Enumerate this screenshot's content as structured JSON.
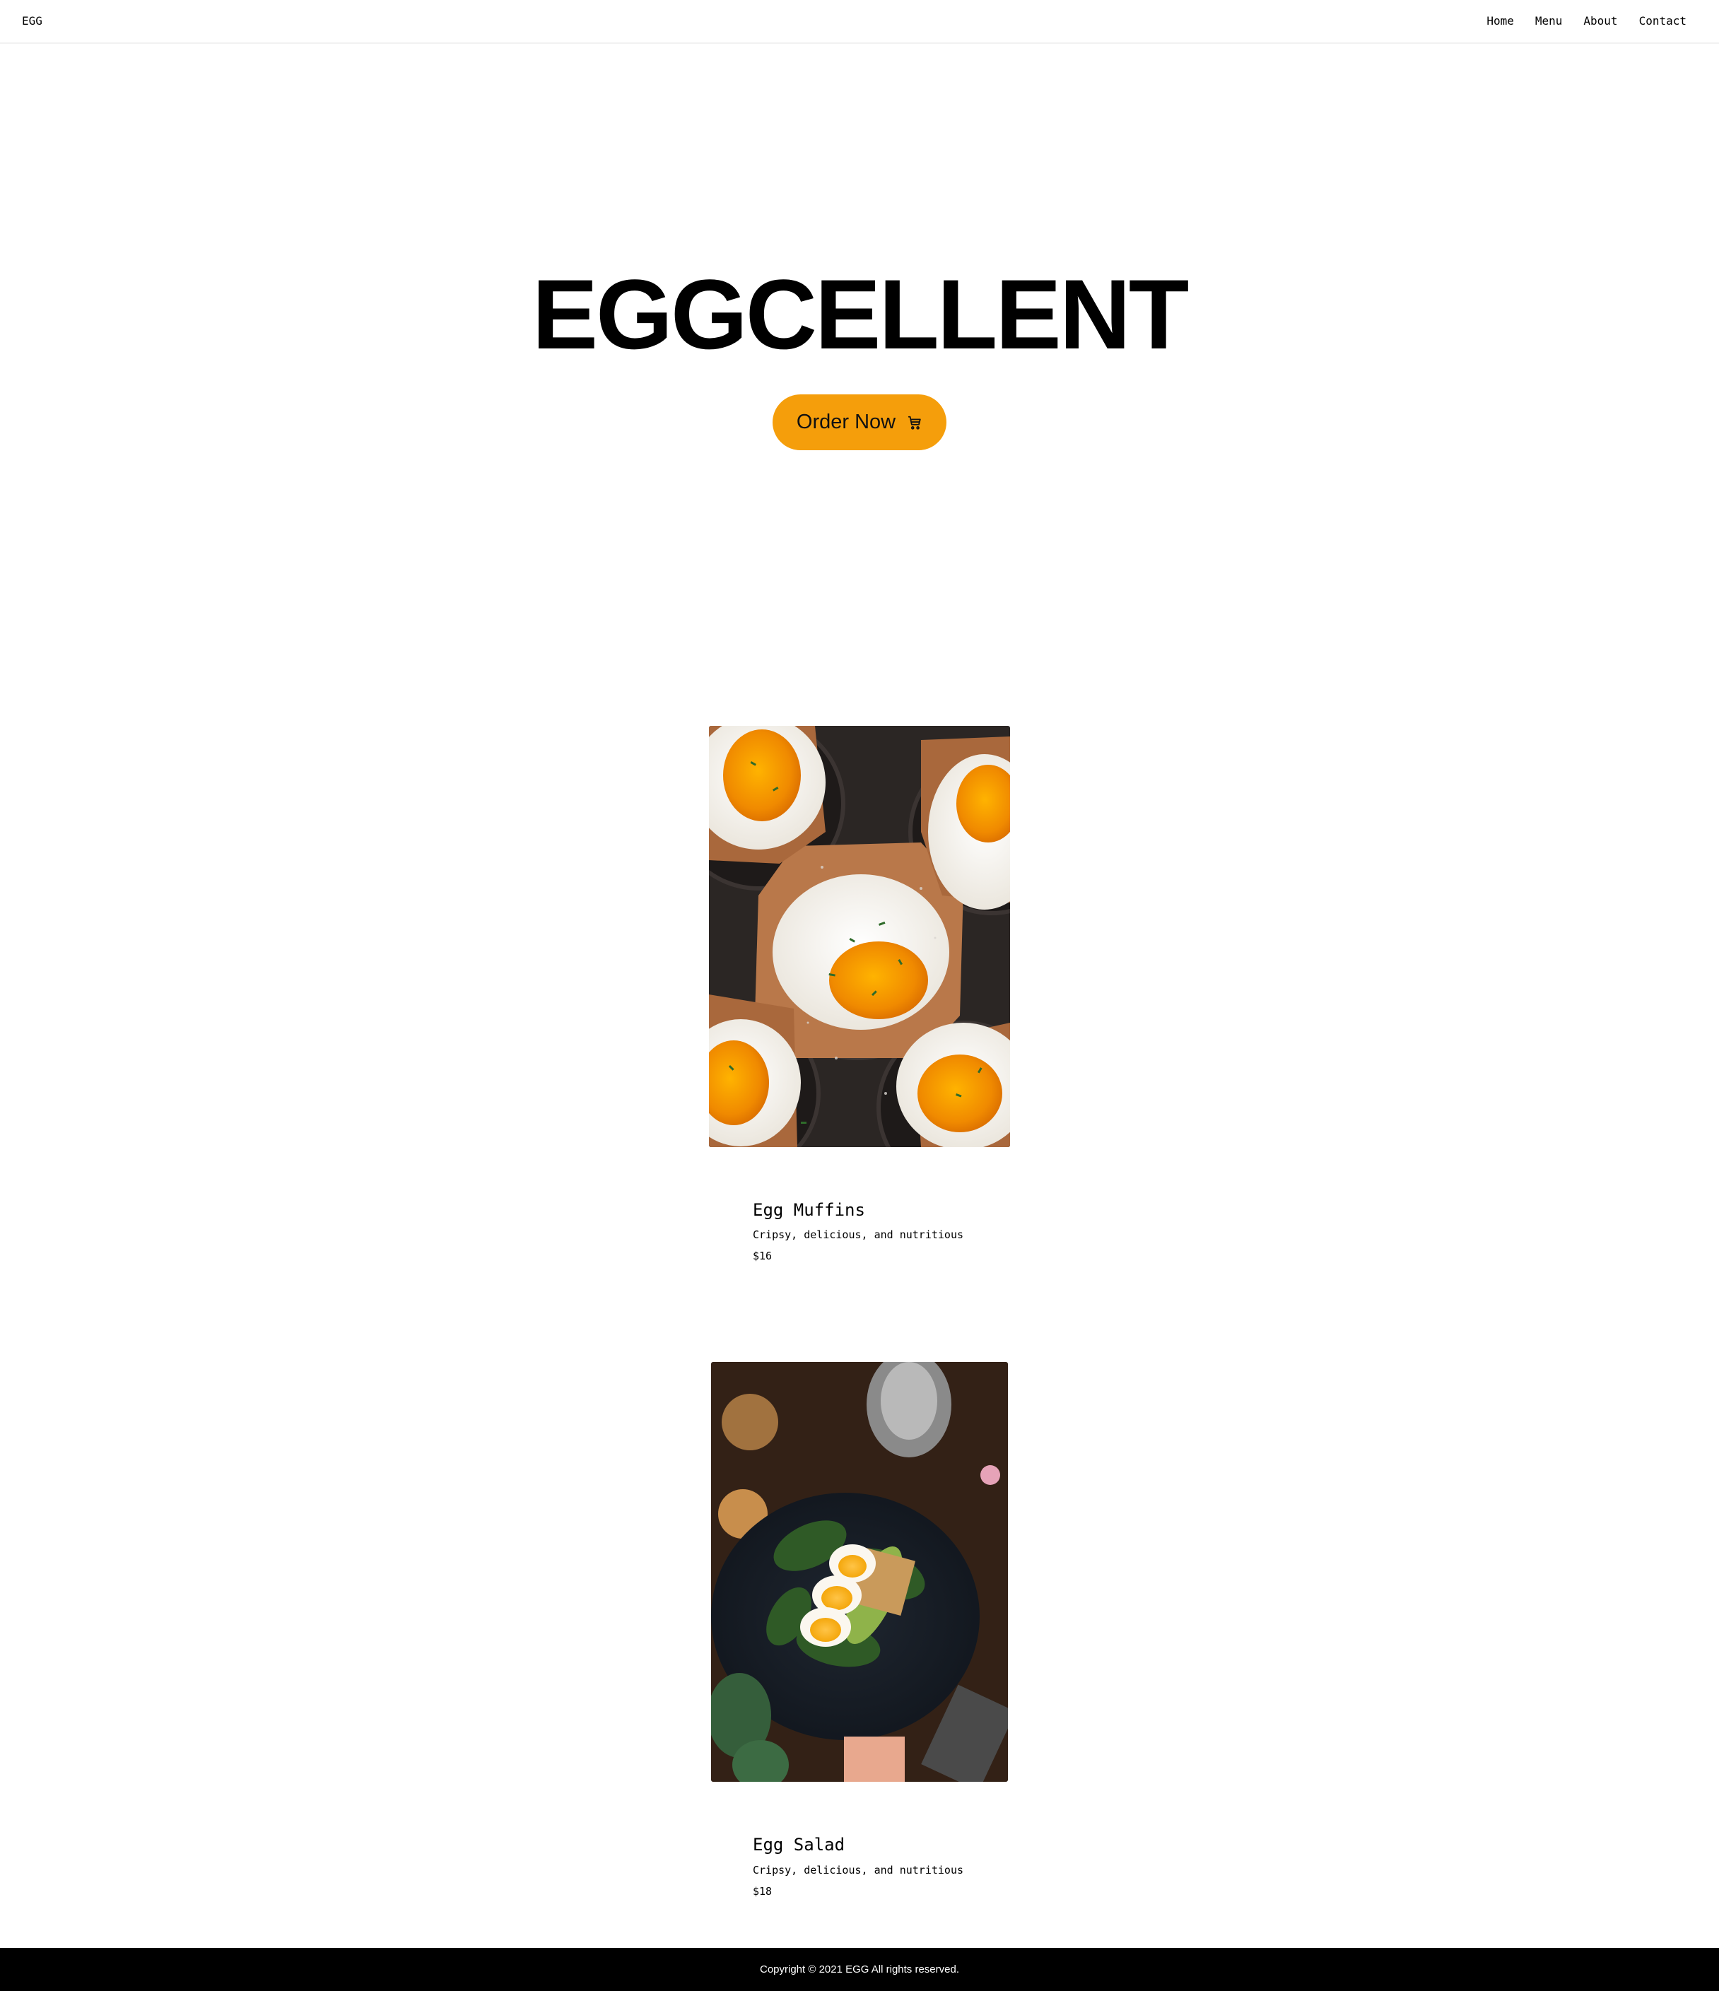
{
  "header": {
    "logo": "EGG",
    "nav": [
      "Home",
      "Menu",
      "About",
      "Contact"
    ]
  },
  "hero": {
    "title": "EGGCELLENT",
    "cta_label": "Order Now",
    "cta_icon": "cart-icon",
    "cta_color": "#f59e0b"
  },
  "menu": {
    "items": [
      {
        "name": "Egg Muffins",
        "description": "Cripsy, delicious, and nutritious",
        "price": "$16",
        "image": "baked-eggs-in-muffin-tin-photo"
      },
      {
        "name": "Egg Salad",
        "description": "Cripsy, delicious, and nutritious",
        "price": "$18",
        "image": "egg-avocado-salad-photo"
      }
    ]
  },
  "footer": {
    "copyright": "Copyright © 2021 EGG All rights reserved."
  }
}
